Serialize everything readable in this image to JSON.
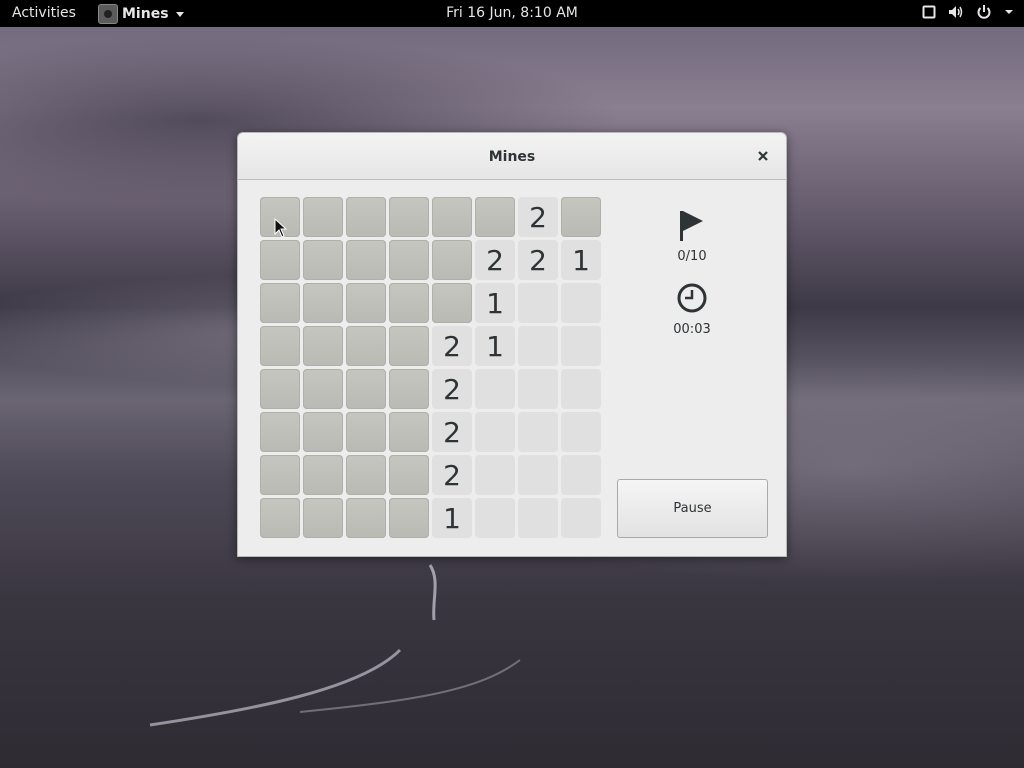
{
  "topbar": {
    "activities": "Activities",
    "app_name": "Mines",
    "datetime": "Fri 16 Jun,  8:10 AM"
  },
  "window": {
    "title": "Mines",
    "close_icon": "close-icon"
  },
  "game": {
    "rows": 8,
    "cols": 8,
    "grid": [
      [
        "#",
        "#",
        "#",
        "#",
        "#",
        "#",
        "2",
        "#"
      ],
      [
        "#",
        "#",
        "#",
        "#",
        "#",
        "2",
        "2",
        "1"
      ],
      [
        "#",
        "#",
        "#",
        "#",
        "#",
        "1",
        "",
        ""
      ],
      [
        "#",
        "#",
        "#",
        "#",
        "2",
        "1",
        "",
        ""
      ],
      [
        "#",
        "#",
        "#",
        "#",
        "2",
        "",
        "",
        ""
      ],
      [
        "#",
        "#",
        "#",
        "#",
        "2",
        "",
        "",
        ""
      ],
      [
        "#",
        "#",
        "#",
        "#",
        "2",
        "",
        "",
        ""
      ],
      [
        "#",
        "#",
        "#",
        "#",
        "1",
        "",
        "",
        ""
      ]
    ]
  },
  "side": {
    "flags": "0/10",
    "time": "00:03",
    "pause_label": "Pause",
    "flag_icon": "flag-icon",
    "clock_icon": "clock-icon"
  },
  "tray_icons": [
    "screen-icon",
    "volume-icon",
    "power-icon",
    "chevron-down-icon"
  ]
}
